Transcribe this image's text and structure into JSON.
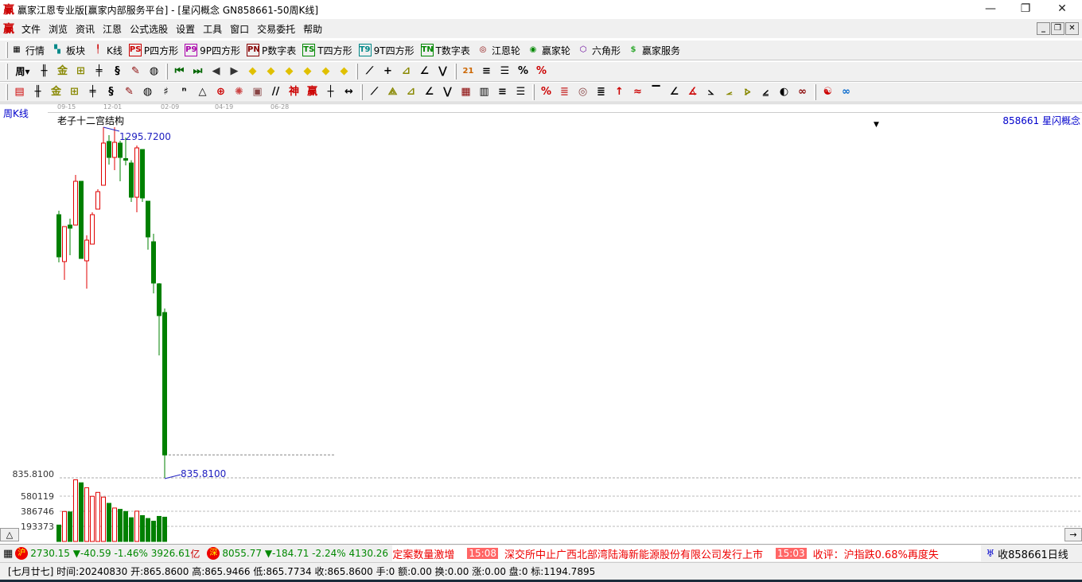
{
  "window": {
    "logo": "赢",
    "title": "赢家江恩专业版[赢家内部服务平台] - [星闪概念  GN858661-50周K线]",
    "minimize": "—",
    "restore": "❐",
    "close": "✕"
  },
  "menu": [
    "文件",
    "浏览",
    "资讯",
    "江恩",
    "公式选股",
    "设置",
    "工具",
    "窗口",
    "交易委托",
    "帮助"
  ],
  "toolbar1": [
    {
      "icon": "grid-table-icon",
      "tag": "▦",
      "label": "行情",
      "color": "#000"
    },
    {
      "icon": "blocks-icon",
      "tag": "▚",
      "label": "板块",
      "color": "#088"
    },
    {
      "icon": "kline-icon",
      "tag": "╿",
      "label": "K线",
      "color": "#c00"
    },
    {
      "icon": "ps-icon",
      "tag": "PS",
      "label": "P四方形",
      "color": "#c00"
    },
    {
      "icon": "p9-icon",
      "tag": "P9",
      "label": "9P四方形",
      "color": "#a0a"
    },
    {
      "icon": "pn-icon",
      "tag": "PN",
      "label": "P数字表",
      "color": "#800"
    },
    {
      "icon": "ts-icon",
      "tag": "TS",
      "label": "T四方形",
      "color": "#080"
    },
    {
      "icon": "t9-icon",
      "tag": "T9",
      "label": "9T四方形",
      "color": "#088"
    },
    {
      "icon": "tn-icon",
      "tag": "TN",
      "label": "T数字表",
      "color": "#080"
    },
    {
      "icon": "gann-wheel-icon",
      "tag": "◎",
      "label": "江恩轮",
      "color": "#800"
    },
    {
      "icon": "winner-wheel-icon",
      "tag": "◉",
      "label": "赢家轮",
      "color": "#080"
    },
    {
      "icon": "hexagon-icon",
      "tag": "⬡",
      "label": "六角形",
      "color": "#609"
    },
    {
      "icon": "dollar-icon",
      "tag": "$",
      "label": "赢家服务",
      "color": "#3a3"
    }
  ],
  "toolbar2": [
    "period-week-dropdown",
    "gann-icon",
    "note-icon",
    "chart-3-icon",
    "chart-9-icon",
    "candle-dropdown",
    "sigma-icon",
    "flag-icon",
    "|",
    "first-page-icon",
    "last-page-icon",
    "left-arrow-icon",
    "right-arrow-icon",
    "diamond-left-icon",
    "diamond-right-icon",
    "diamond-expand-icon",
    "diamond-shrink-icon",
    "diamond-up-icon",
    "diamond-all-icon",
    "|",
    "hand-icon",
    "crosshair-icon",
    "wave-icon",
    "node-icon",
    "cycle-icon",
    "|",
    "calendar-icon",
    "calculator-icon",
    "notebook-icon",
    "save-icon",
    "print-icon"
  ],
  "toolbar3": [
    "pen-icon",
    "hash-icon",
    "gold-1-icon",
    "gold-2-icon",
    "fib-icon",
    "spiral-icon",
    "pen2-icon",
    "circle-grid-icon",
    "hash2-icon",
    "n2-icon",
    "triangle-icon",
    "target-icon",
    "star-icon",
    "square-spiral-icon",
    "parallel-icon",
    "god-icon",
    "win-icon",
    "comb-icon",
    "measure-icon",
    "|",
    "box-icon",
    "fan-icon",
    "fan-box-icon",
    "fan-box2-icon",
    "angle-icon",
    "zigzag-icon",
    "grid-icon",
    "grid2-icon",
    "lines-icon",
    "|",
    "list-icon",
    "pct-slash-icon",
    "percent-icon",
    "pct-lines-icon",
    "gold-coin-icon",
    "gold-lines-icon",
    "arrow-up-icon",
    "gold-wave-icon",
    "gold-bar-icon",
    "angle2-icon",
    "f-angle-icon",
    "gold-angle-icon",
    "god-angle-icon",
    "win-angle-icon",
    "four-angle-icon",
    "|",
    "yin-yang-icon",
    "infinity-icon"
  ],
  "chart": {
    "period_label": "周K线",
    "indicator_name": "老子十二宫结构",
    "code_label": "858661  星闪概念",
    "date_ruler": [
      "09-15",
      "12-01",
      "02-09",
      "04-19",
      "06-28"
    ],
    "vol_axis_labels": [
      "835.8100",
      "580119",
      "386746",
      "193373"
    ]
  },
  "chart_data": {
    "type": "candlestick",
    "title": "星闪概念 GN858661 周K线",
    "high_label": "1295.7200",
    "low_label": "835.8100",
    "ylim": [
      835.81,
      1295.72
    ],
    "candles": [
      {
        "o": 1181.0,
        "h": 1186.2,
        "l": 1118.4,
        "c": 1125.7
      },
      {
        "o": 1119.5,
        "h": 1165.4,
        "l": 1095.5,
        "c": 1165.4
      },
      {
        "o": 1167.4,
        "h": 1175.8,
        "l": 1127.8,
        "c": 1163.3
      },
      {
        "o": 1167.4,
        "h": 1233.2,
        "l": 1167.4,
        "c": 1224.8
      },
      {
        "o": 1224.8,
        "h": 1224.8,
        "l": 1123.6,
        "c": 1123.6
      },
      {
        "o": 1120.5,
        "h": 1153.9,
        "l": 1084.0,
        "c": 1147.6
      },
      {
        "o": 1142.4,
        "h": 1184.1,
        "l": 1142.4,
        "c": 1181.0
      },
      {
        "o": 1188.3,
        "h": 1214.4,
        "l": 1188.3,
        "c": 1211.2
      },
      {
        "o": 1219.6,
        "h": 1295.7,
        "l": 1219.6,
        "c": 1274.9
      },
      {
        "o": 1277.0,
        "h": 1285.3,
        "l": 1246.7,
        "c": 1256.1
      },
      {
        "o": 1256.1,
        "h": 1295.72,
        "l": 1239.4,
        "c": 1275.9
      },
      {
        "o": 1274.9,
        "h": 1278.0,
        "l": 1224.8,
        "c": 1256.1
      },
      {
        "o": 1254.6,
        "h": 1282.2,
        "l": 1245.7,
        "c": 1252.5
      },
      {
        "o": 1248.8,
        "h": 1252.5,
        "l": 1197.7,
        "c": 1203.9
      },
      {
        "o": 1203.9,
        "h": 1271.7,
        "l": 1184.1,
        "c": 1268.6
      },
      {
        "o": 1266.5,
        "h": 1266.5,
        "l": 1197.7,
        "c": 1202.9
      },
      {
        "o": 1198.7,
        "h": 1198.7,
        "l": 1135.1,
        "c": 1151.8
      },
      {
        "o": 1145.5,
        "h": 1156.0,
        "l": 1077.8,
        "c": 1091.3
      },
      {
        "o": 1090.3,
        "h": 1091.3,
        "l": 996.4,
        "c": 1048.6
      },
      {
        "o": 1052.7,
        "h": 1058.0,
        "l": 835.81,
        "c": 865.86
      }
    ],
    "volume": [
      210000,
      384000,
      378000,
      789000,
      751000,
      688000,
      578000,
      628000,
      568000,
      488000,
      428000,
      411000,
      384000,
      304000,
      388000,
      331000,
      294000,
      260000,
      321000,
      311000
    ],
    "volume_ticks": [
      193373,
      386746,
      580119
    ],
    "colors": {
      "up": "#e00000",
      "down": "#008000",
      "annotation": "#2020c0"
    }
  },
  "ticker": {
    "sh_badge": "沪",
    "sh_text": "2730.15 ▼-40.59 -1.46% 3926.61",
    "sh_unit": "亿",
    "sz_badge": "深",
    "sz_text": "8055.77 ▼-184.71 -2.24% 4130.26",
    "news": [
      {
        "time": "",
        "text": "定案数量激增"
      },
      {
        "time": "15:08",
        "text": "深交所中止广西北部湾陆海新能源股份有限公司发行上市"
      },
      {
        "time": "15:03",
        "text": "收评：沪指跌0.68%再度失"
      }
    ],
    "signal_text": "收858661日线"
  },
  "status": "[七月廿七] 时间:20240830 开:865.8600 高:865.9466 低:865.7734 收:865.8600 手:0 额:0.00 换:0.00 涨:0.00 盘:0 标:1194.7895",
  "scroll": {
    "up": "△",
    "right": "→"
  }
}
